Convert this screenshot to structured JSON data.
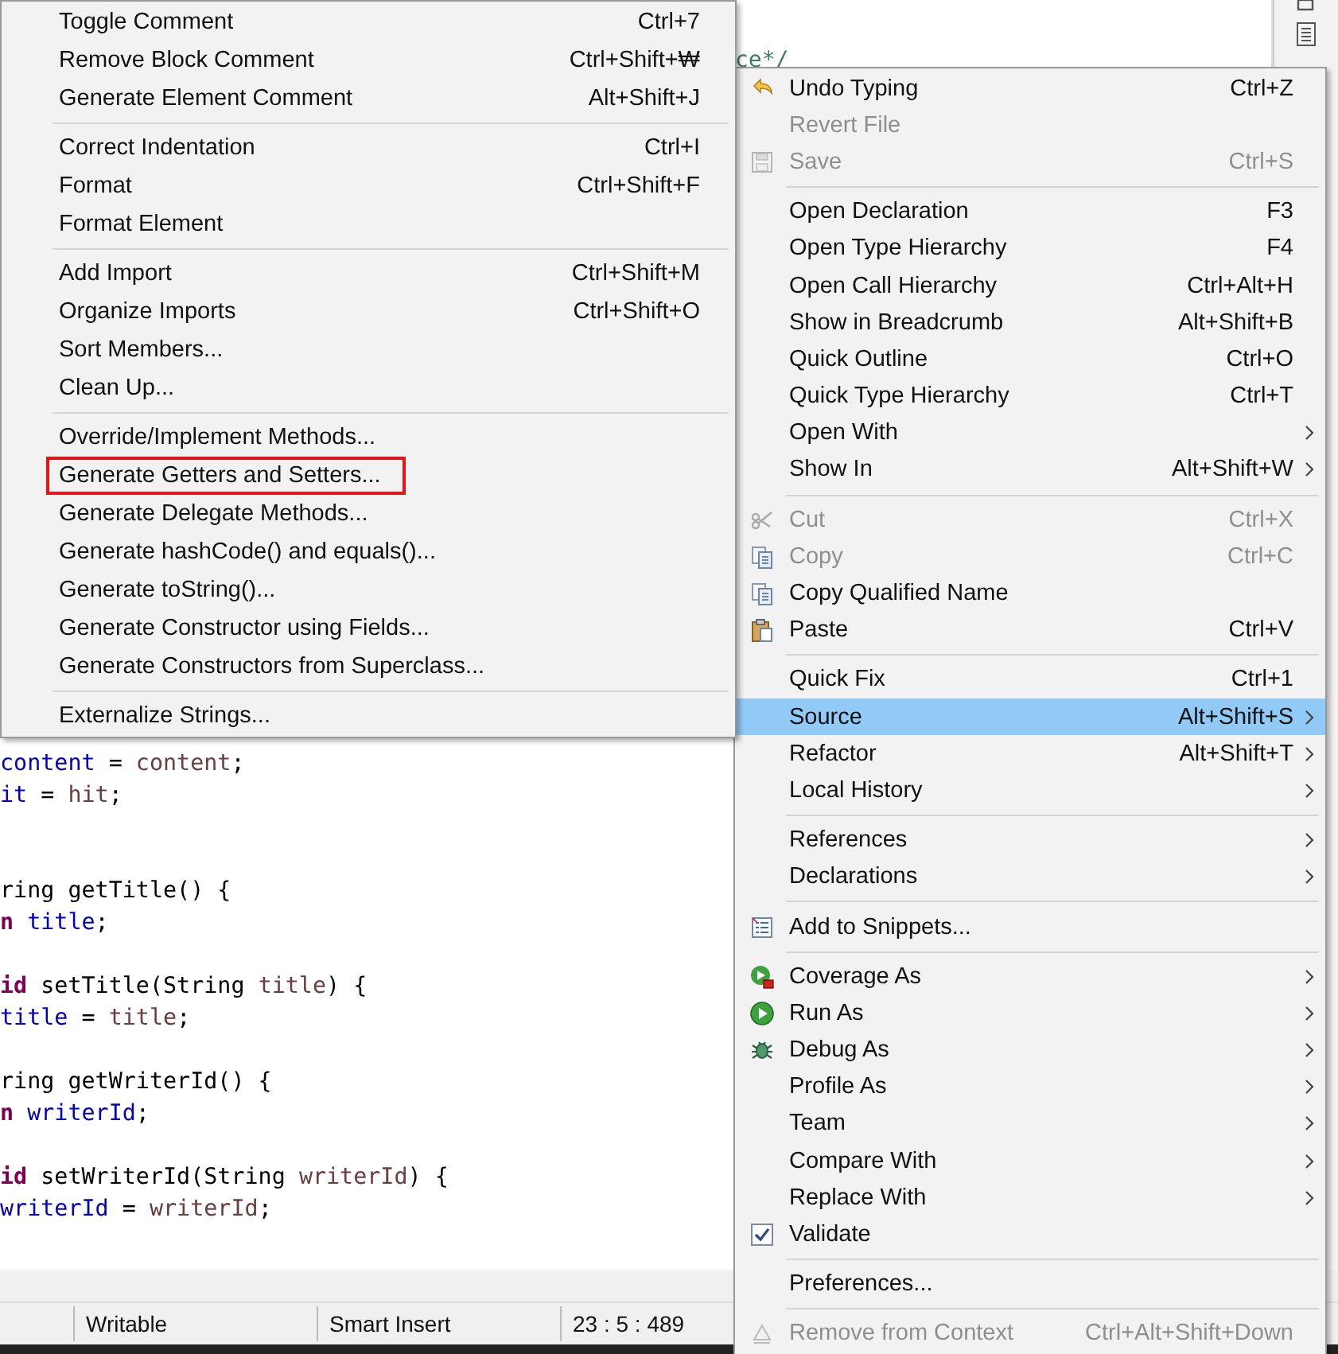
{
  "editor": {
    "comment": "ce*/",
    "code_lines": [
      {
        "kind": "code",
        "segments": [
          {
            "kind": "field",
            "text": "content"
          },
          {
            "kind": "plain",
            "text": " = "
          },
          {
            "kind": "param",
            "text": "content"
          },
          {
            "kind": "plain",
            "text": ";"
          }
        ]
      },
      {
        "kind": "code",
        "segments": [
          {
            "kind": "field",
            "text": "it"
          },
          {
            "kind": "plain",
            "text": " = "
          },
          {
            "kind": "param",
            "text": "hit"
          },
          {
            "kind": "plain",
            "text": ";"
          }
        ]
      },
      {
        "kind": "blank"
      },
      {
        "kind": "blank"
      },
      {
        "kind": "code",
        "segments": [
          {
            "kind": "plain",
            "text": "ring getTitle() {"
          }
        ]
      },
      {
        "kind": "code",
        "segments": [
          {
            "kind": "keyword",
            "text": "n"
          },
          {
            "kind": "field",
            "text": " title"
          },
          {
            "kind": "plain",
            "text": ";"
          }
        ]
      },
      {
        "kind": "blank"
      },
      {
        "kind": "code",
        "segments": [
          {
            "kind": "keyword",
            "text": "id"
          },
          {
            "kind": "plain",
            "text": " setTitle(String "
          },
          {
            "kind": "param",
            "text": "title"
          },
          {
            "kind": "plain",
            "text": ") {"
          }
        ]
      },
      {
        "kind": "code",
        "segments": [
          {
            "kind": "field",
            "text": "title"
          },
          {
            "kind": "plain",
            "text": " = "
          },
          {
            "kind": "param",
            "text": "title"
          },
          {
            "kind": "plain",
            "text": ";"
          }
        ]
      },
      {
        "kind": "blank"
      },
      {
        "kind": "code",
        "segments": [
          {
            "kind": "plain",
            "text": "ring getWriterId() {"
          }
        ]
      },
      {
        "kind": "code",
        "segments": [
          {
            "kind": "keyword",
            "text": "n"
          },
          {
            "kind": "field",
            "text": " writerId"
          },
          {
            "kind": "plain",
            "text": ";"
          }
        ]
      },
      {
        "kind": "blank"
      },
      {
        "kind": "code",
        "segments": [
          {
            "kind": "keyword",
            "text": "id"
          },
          {
            "kind": "plain",
            "text": " setWriterId(String "
          },
          {
            "kind": "param",
            "text": "writerId"
          },
          {
            "kind": "plain",
            "text": ") {"
          }
        ]
      },
      {
        "kind": "code",
        "segments": [
          {
            "kind": "field",
            "text": "writerId"
          },
          {
            "kind": "plain",
            "text": " = "
          },
          {
            "kind": "param",
            "text": "writerId"
          },
          {
            "kind": "plain",
            "text": ";"
          }
        ]
      }
    ]
  },
  "status_bar": [
    "Writable",
    "Smart Insert",
    "23 : 5 : 489"
  ],
  "source_menu": {
    "groups": [
      [
        {
          "label": "Toggle Comment",
          "shortcut": "Ctrl+7",
          "outlined": false
        },
        {
          "label": "Remove Block Comment",
          "shortcut": "Ctrl+Shift+₩",
          "outlined": false
        },
        {
          "label": "Generate Element Comment",
          "shortcut": "Alt+Shift+J",
          "outlined": false
        }
      ],
      [
        {
          "label": "Correct Indentation",
          "shortcut": "Ctrl+I",
          "outlined": false
        },
        {
          "label": "Format",
          "shortcut": "Ctrl+Shift+F",
          "outlined": false
        },
        {
          "label": "Format Element",
          "outlined": false
        }
      ],
      [
        {
          "label": "Add Import",
          "shortcut": "Ctrl+Shift+M",
          "outlined": false
        },
        {
          "label": "Organize Imports",
          "shortcut": "Ctrl+Shift+O",
          "outlined": false
        },
        {
          "label": "Sort Members...",
          "outlined": false
        },
        {
          "label": "Clean Up...",
          "outlined": false
        }
      ],
      [
        {
          "label": "Override/Implement Methods...",
          "outlined": false
        },
        {
          "label": "Generate Getters and Setters...",
          "outlined": true
        },
        {
          "label": "Generate Delegate Methods...",
          "outlined": false
        },
        {
          "label": "Generate hashCode() and equals()...",
          "outlined": false
        },
        {
          "label": "Generate toString()...",
          "outlined": false
        },
        {
          "label": "Generate Constructor using Fields...",
          "outlined": false
        },
        {
          "label": "Generate Constructors from Superclass...",
          "outlined": false
        }
      ],
      [
        {
          "label": "Externalize Strings...",
          "outlined": false
        }
      ]
    ]
  },
  "context_menu": {
    "groups": [
      [
        {
          "label": "Undo Typing",
          "shortcut": "Ctrl+Z",
          "kind": "undo",
          "disabled": false,
          "selected": false,
          "submenu": false
        },
        {
          "label": "Revert File",
          "disabled": true,
          "selected": false,
          "submenu": false
        },
        {
          "label": "Save",
          "shortcut": "Ctrl+S",
          "kind": "save",
          "disabled": true,
          "selected": false,
          "submenu": false
        }
      ],
      [
        {
          "label": "Open Declaration",
          "shortcut": "F3",
          "disabled": false,
          "selected": false,
          "submenu": false
        },
        {
          "label": "Open Type Hierarchy",
          "shortcut": "F4",
          "disabled": false,
          "selected": false,
          "submenu": false
        },
        {
          "label": "Open Call Hierarchy",
          "shortcut": "Ctrl+Alt+H",
          "disabled": false,
          "selected": false,
          "submenu": false
        },
        {
          "label": "Show in Breadcrumb",
          "shortcut": "Alt+Shift+B",
          "disabled": false,
          "selected": false,
          "submenu": false
        },
        {
          "label": "Quick Outline",
          "shortcut": "Ctrl+O",
          "disabled": false,
          "selected": false,
          "submenu": false
        },
        {
          "label": "Quick Type Hierarchy",
          "shortcut": "Ctrl+T",
          "disabled": false,
          "selected": false,
          "submenu": false
        },
        {
          "label": "Open With",
          "disabled": false,
          "selected": false,
          "submenu": true
        },
        {
          "label": "Show In",
          "shortcut": "Alt+Shift+W",
          "disabled": false,
          "selected": false,
          "submenu": true
        }
      ],
      [
        {
          "label": "Cut",
          "shortcut": "Ctrl+X",
          "kind": "cut",
          "disabled": true,
          "selected": false,
          "submenu": false
        },
        {
          "label": "Copy",
          "shortcut": "Ctrl+C",
          "kind": "copy",
          "disabled": true,
          "selected": false,
          "submenu": false
        },
        {
          "label": "Copy Qualified Name",
          "kind": "copy",
          "disabled": false,
          "selected": false,
          "submenu": false
        },
        {
          "label": "Paste",
          "shortcut": "Ctrl+V",
          "kind": "paste",
          "disabled": false,
          "selected": false,
          "submenu": false
        }
      ],
      [
        {
          "label": "Quick Fix",
          "shortcut": "Ctrl+1",
          "disabled": false,
          "selected": false,
          "submenu": false
        },
        {
          "label": "Source",
          "shortcut": "Alt+Shift+S",
          "disabled": false,
          "selected": true,
          "submenu": true
        },
        {
          "label": "Refactor",
          "shortcut": "Alt+Shift+T",
          "disabled": false,
          "selected": false,
          "submenu": true
        },
        {
          "label": "Local History",
          "disabled": false,
          "selected": false,
          "submenu": true
        }
      ],
      [
        {
          "label": "References",
          "disabled": false,
          "selected": false,
          "submenu": true
        },
        {
          "label": "Declarations",
          "disabled": false,
          "selected": false,
          "submenu": true
        }
      ],
      [
        {
          "label": "Add to Snippets...",
          "kind": "snippets",
          "disabled": false,
          "selected": false,
          "submenu": false
        }
      ],
      [
        {
          "label": "Coverage As",
          "kind": "coverage",
          "disabled": false,
          "selected": false,
          "submenu": true
        },
        {
          "label": "Run As",
          "kind": "run",
          "disabled": false,
          "selected": false,
          "submenu": true
        },
        {
          "label": "Debug As",
          "kind": "debug",
          "disabled": false,
          "selected": false,
          "submenu": true
        },
        {
          "label": "Profile As",
          "disabled": false,
          "selected": false,
          "submenu": true
        },
        {
          "label": "Team",
          "disabled": false,
          "selected": false,
          "submenu": true
        },
        {
          "label": "Compare With",
          "disabled": false,
          "selected": false,
          "submenu": true
        },
        {
          "label": "Replace With",
          "disabled": false,
          "selected": false,
          "submenu": true
        },
        {
          "label": "Validate",
          "kind": "checkbox",
          "checked": true,
          "disabled": false,
          "selected": false,
          "submenu": false
        }
      ],
      [
        {
          "label": "Preferences...",
          "disabled": false,
          "selected": false,
          "submenu": false
        }
      ],
      [
        {
          "label": "Remove from Context",
          "shortcut": "Ctrl+Alt+Shift+Down",
          "kind": "remove",
          "disabled": true,
          "selected": false,
          "submenu": false
        }
      ]
    ]
  }
}
